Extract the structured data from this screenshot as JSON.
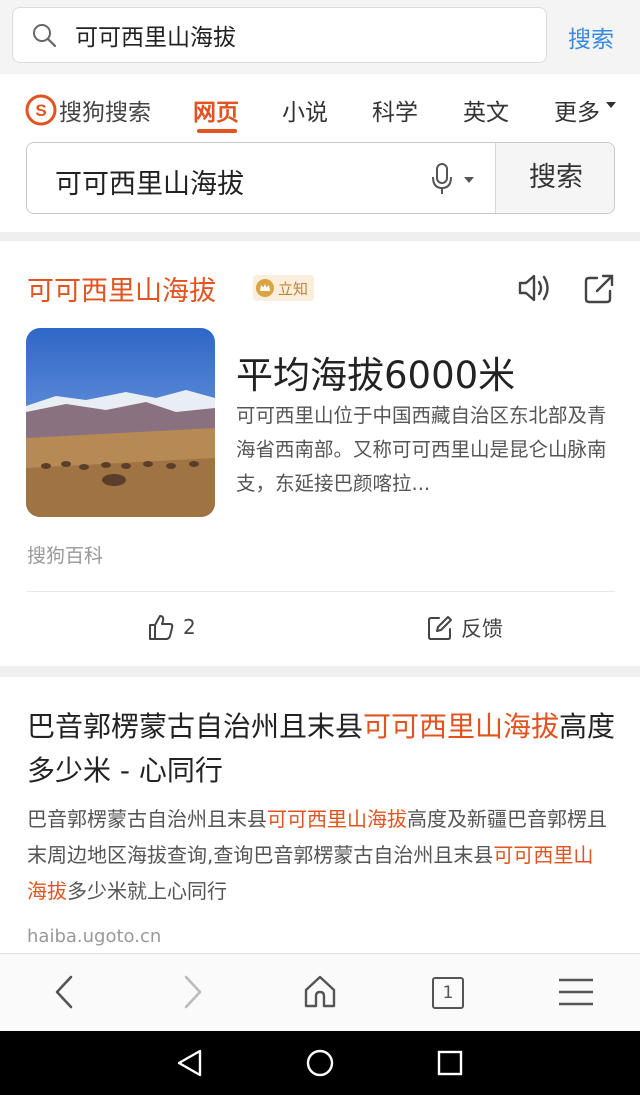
{
  "browser": {
    "address_text": "可可西里山海拔",
    "search_button": "搜索",
    "tab_count": "1"
  },
  "sogou": {
    "logo_text": "搜狗搜索",
    "tabs": [
      "网页",
      "小说",
      "科学",
      "英文",
      "更多"
    ],
    "active_tab": "网页",
    "query": "可可西里山海拔",
    "search_button": "搜索"
  },
  "result1": {
    "title": "可可西里山海拔",
    "badge": "立知",
    "headline": "平均海拔6000米",
    "description": "可可西里山位于中国西藏自治区东北部及青海省西南部。又称可可西里山是昆仑山脉南支，东延接巴颜喀拉...",
    "source": "搜狗百科",
    "like_count": "2",
    "feedback_label": "反馈"
  },
  "result2": {
    "title_prefix": "巴音郭楞蒙古自治州且末县",
    "title_highlight": "可可西里山海拔",
    "title_suffix": "高度多少米 - 心同行",
    "snippet_1": "巴音郭楞蒙古自治州且末县",
    "snippet_hl_1": "可可西里山海拔",
    "snippet_2": "高度及新疆巴音郭楞且末周边地区海拔查询,查询巴音郭楞蒙古自治州且末县",
    "snippet_hl_2": "可可西里山海拔",
    "snippet_3": "多少米就上心同行",
    "url": "haiba.ugoto.cn"
  },
  "colors": {
    "accent": "#e2531f",
    "link_blue": "#3a8be0"
  },
  "icons": [
    "search-icon",
    "sogou-logo-icon",
    "mic-icon",
    "speaker-icon",
    "share-icon",
    "thumbs-up-icon",
    "edit-icon",
    "back-icon",
    "forward-icon",
    "home-icon",
    "menu-icon",
    "android-back-icon",
    "android-home-icon",
    "android-recents-icon"
  ]
}
